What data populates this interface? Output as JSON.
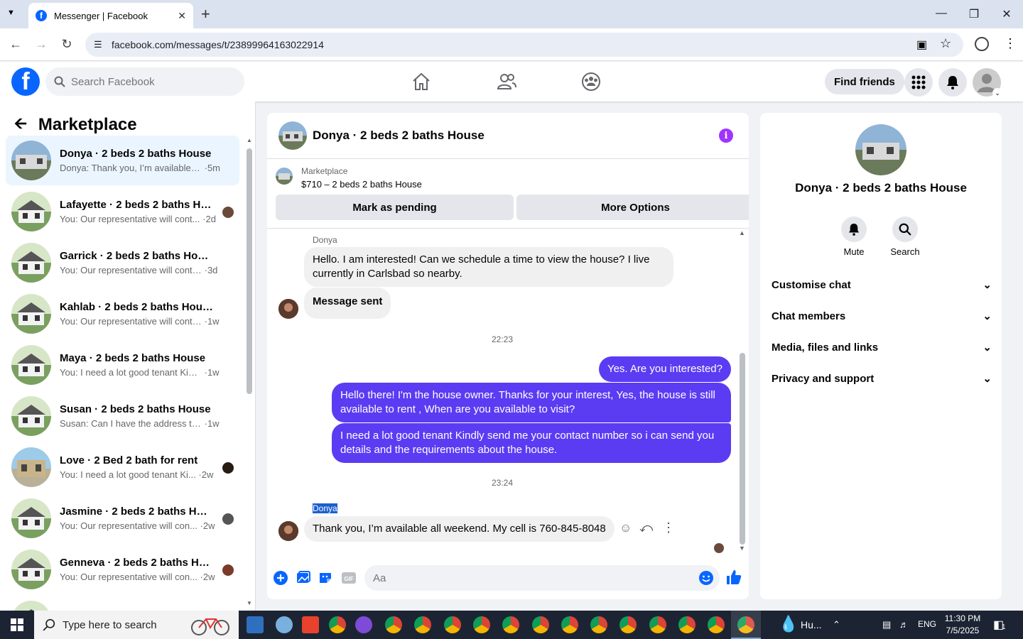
{
  "browser": {
    "tab_title": "Messenger | Facebook",
    "url": "facebook.com/messages/t/23899964163022914"
  },
  "header": {
    "search_placeholder": "Search Facebook",
    "find_friends": "Find friends"
  },
  "sidebar": {
    "title": "Marketplace",
    "conversations": [
      {
        "name": "Donya · 2 beds 2 baths House",
        "preview": "Donya: Thank you, I’m available all...",
        "time": "5m",
        "active": true
      },
      {
        "name": "Lafayette · 2 beds 2 baths Ho...",
        "preview": "You: Our representative will cont...",
        "time": "2d"
      },
      {
        "name": "Garrick · 2 beds 2 baths House",
        "preview": "You: Our representative will contra...",
        "time": "3d"
      },
      {
        "name": "Kahlab · 2 beds 2 baths House",
        "preview": "You: Our representative will contra...",
        "time": "1w"
      },
      {
        "name": "Maya · 2 beds 2 baths House",
        "preview": "You: I need a lot good tenant Kindl...",
        "time": "1w"
      },
      {
        "name": "Susan · 2 beds 2 baths House",
        "preview": "Susan: Can I have the address to s...",
        "time": "1w"
      },
      {
        "name": "Love · 2 Bed 2 bath for rent",
        "preview": "You: I need a lot good tenant Ki...",
        "time": "2w"
      },
      {
        "name": "Jasmine · 2 beds 2 baths House",
        "preview": "You: Our representative will con...",
        "time": "2w"
      },
      {
        "name": "Genneva · 2 beds 2 baths Hou...",
        "preview": "You: Our representative will con...",
        "time": "2w"
      }
    ]
  },
  "chat": {
    "title": "Donya · 2 beds 2 baths House",
    "marketplace_label": "Marketplace",
    "listing": "$710 – 2 beds 2 baths House",
    "mark_pending": "Mark as pending",
    "more_options": "More Options",
    "sender1": "Donya",
    "msg_in_1": "Hello. I am interested! Can we schedule a time to view the house?  I live currently in Carlsbad so nearby.",
    "msg_in_2": "Message sent",
    "time1": "22:23",
    "msg_out_1": "Yes. Are you interested?",
    "msg_out_2": "Hello there! I'm the house owner. Thanks for your interest, Yes, the house is still available to rent , When are you available to visit?",
    "msg_out_3": "I need a lot good tenant Kindly send me your contact number so i can send you details and the requirements about the house.",
    "time2": "23:24",
    "sender2": "Donya",
    "msg_in_3": "Thank you, I’m available all weekend.  My cell is 760-845-8048",
    "composer_placeholder": "Aa"
  },
  "details": {
    "name": "Donya · 2 beds 2 baths House",
    "mute": "Mute",
    "search": "Search",
    "sections": [
      "Customise chat",
      "Chat members",
      "Media, files and links",
      "Privacy and support"
    ]
  },
  "taskbar": {
    "search_placeholder": "Type here to search",
    "weather": "Hu...",
    "lang": "ENG",
    "time": "11:30 PM",
    "date": "7/5/2025",
    "notif_count": "1"
  },
  "colors": {
    "accent": "#5b3cf3",
    "facebook_blue": "#0866ff"
  }
}
